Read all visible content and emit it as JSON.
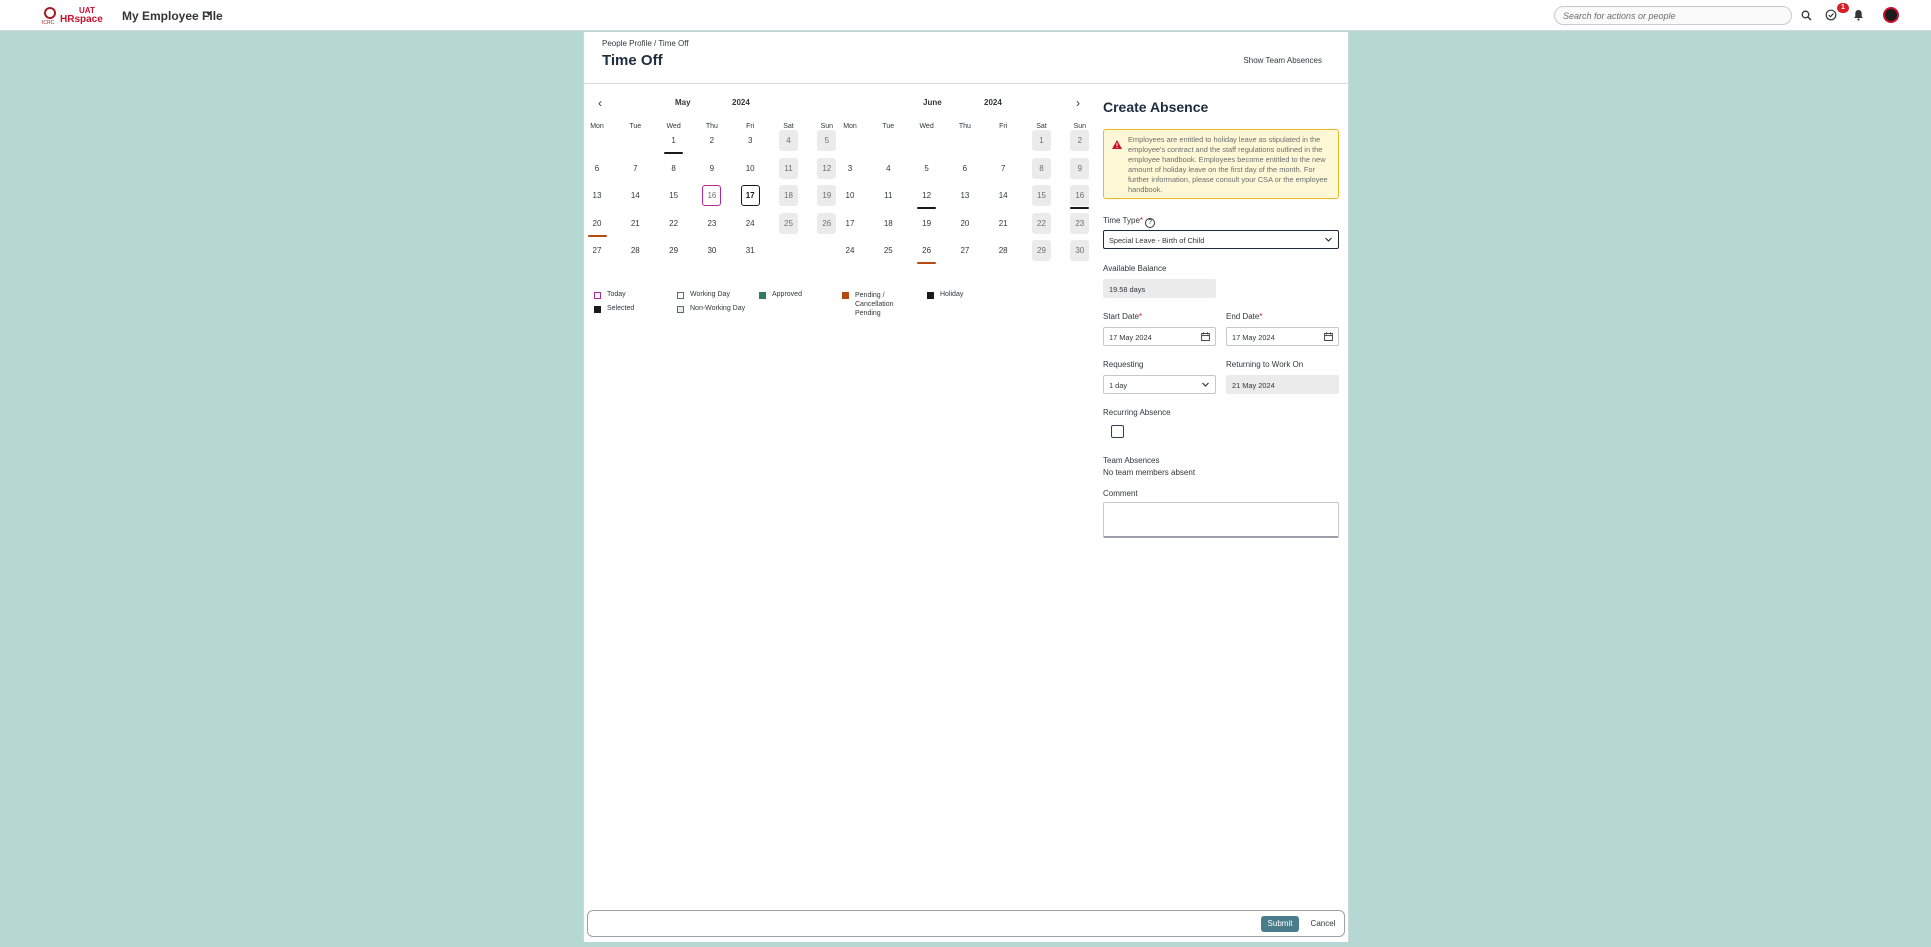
{
  "topbar": {
    "logo_env": "UAT",
    "logo_name": "HRspace",
    "logo_org": "ICRC",
    "app_title": "My Employee File",
    "search_placeholder": "Search for actions or people",
    "notification_count": "1"
  },
  "page": {
    "breadcrumb": "People Profile / Time Off",
    "title": "Time Off",
    "show_team_absences": "Show Team Absences"
  },
  "calendar": {
    "weekday_labels": [
      "Mon",
      "Tue",
      "Wed",
      "Thu",
      "Fri",
      "Sat",
      "Sun"
    ],
    "months": [
      {
        "month": "May",
        "year": "2024",
        "weeks": [
          [
            "",
            "",
            "1",
            "2",
            "3",
            "4",
            "5"
          ],
          [
            "6",
            "7",
            "8",
            "9",
            "10",
            "11",
            "12"
          ],
          [
            "13",
            "14",
            "15",
            "16",
            "17",
            "18",
            "19"
          ],
          [
            "20",
            "21",
            "22",
            "23",
            "24",
            "25",
            "26"
          ],
          [
            "27",
            "28",
            "29",
            "30",
            "31",
            "",
            ""
          ]
        ],
        "holidays": [
          "1"
        ],
        "pending": [
          "20"
        ],
        "today": "16",
        "selected": "17"
      },
      {
        "month": "June",
        "year": "2024",
        "weeks": [
          [
            "",
            "",
            "",
            "",
            "",
            "1",
            "2"
          ],
          [
            "3",
            "4",
            "5",
            "6",
            "7",
            "8",
            "9"
          ],
          [
            "10",
            "11",
            "12",
            "13",
            "14",
            "15",
            "16"
          ],
          [
            "17",
            "18",
            "19",
            "20",
            "21",
            "22",
            "23"
          ],
          [
            "24",
            "25",
            "26",
            "27",
            "28",
            "29",
            "30"
          ]
        ],
        "holidays": [
          "12",
          "16"
        ],
        "pending": [
          "26"
        ],
        "today": "",
        "selected": ""
      }
    ],
    "legend": [
      {
        "label": "Today",
        "color": "#ffffff",
        "border": "#b0299c"
      },
      {
        "label": "Working Day",
        "color": "#ffffff",
        "border": "#5a6a7a"
      },
      {
        "label": "Approved",
        "color": "#2e7d5b",
        "border": "#2e7d5b"
      },
      {
        "label": "Pending / Cancellation Pending",
        "color": "#b34b10",
        "border": "#b34b10"
      },
      {
        "label": "Holiday",
        "color": "#1a1a1a",
        "border": "#1a1a1a"
      },
      {
        "label": "Selected",
        "color": "#1a1a1a",
        "border": "#1a1a1a"
      },
      {
        "label": "Non-Working Day",
        "color": "#ebebeb",
        "border": "#5a6a7a"
      }
    ]
  },
  "form": {
    "title": "Create Absence",
    "warning": "Employees are entitled to holiday leave as stipulated in the employee's contract and the staff regulations outlined in the employee handbook. Employees become entitled to the new amount of holiday leave on the first day of the month. For further information, please consult your CSA or the employee handbook.",
    "time_type_label": "Time Type",
    "time_type_value": "Special Leave - Birth of Child",
    "available_balance_label": "Available Balance",
    "available_balance_value": "19.58 days",
    "start_date_label": "Start Date",
    "start_date_value": "17 May 2024",
    "end_date_label": "End Date",
    "end_date_value": "17 May 2024",
    "requesting_label": "Requesting",
    "requesting_value": "1 day",
    "returning_label": "Returning to Work On",
    "returning_value": "21 May 2024",
    "recurring_label": "Recurring Absence",
    "team_absences_label": "Team Absences",
    "team_absences_value": "No team members absent",
    "comment_label": "Comment",
    "comment_value": ""
  },
  "footer": {
    "submit_label": "Submit",
    "cancel_label": "Cancel"
  },
  "colors": {
    "background": "#b5d8d3",
    "brand_red": "#c8102e",
    "submit_button": "#4a7d8c",
    "warning_bg": "#fff8d6",
    "warning_border": "#e9b824"
  }
}
